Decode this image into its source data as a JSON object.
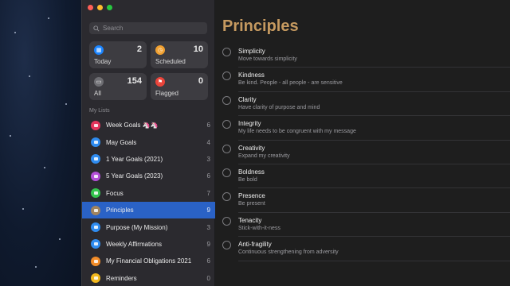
{
  "search": {
    "placeholder": "Search"
  },
  "smart_lists": [
    {
      "label": "Today",
      "count": "2",
      "color": "#1a84ff",
      "icon": "calendar-icon"
    },
    {
      "label": "Scheduled",
      "count": "10",
      "color": "#f0a030",
      "icon": "clock-icon"
    },
    {
      "label": "All",
      "count": "154",
      "color": "#6e6e73",
      "icon": "tray-icon"
    },
    {
      "label": "Flagged",
      "count": "0",
      "color": "#e9443a",
      "icon": "flag-icon"
    }
  ],
  "my_lists_title": "My Lists",
  "lists": [
    {
      "name": "Week Goals 🦄🦄",
      "count": "6",
      "color": "#e4355c"
    },
    {
      "name": "May Goals",
      "count": "4",
      "color": "#2f8cf0"
    },
    {
      "name": "1 Year Goals (2021)",
      "count": "3",
      "color": "#2f8cf0"
    },
    {
      "name": "5 Year Goals (2023)",
      "count": "6",
      "color": "#b44fd7"
    },
    {
      "name": "Focus",
      "count": "7",
      "color": "#34c44e"
    },
    {
      "name": "Principles",
      "count": "9",
      "color": "#a2845e",
      "selected": true
    },
    {
      "name": "Purpose (My Mission)",
      "count": "3",
      "color": "#2f8cf0"
    },
    {
      "name": "Weekly Affirmations",
      "count": "9",
      "color": "#2f8cf0"
    },
    {
      "name": "My Financial Obligations  2021",
      "count": "6",
      "color": "#f28c28"
    },
    {
      "name": "Reminders",
      "count": "0",
      "color": "#f2b81d"
    }
  ],
  "main": {
    "title": "Principles",
    "title_color": "#c69a60",
    "reminders": [
      {
        "title": "Simplicity",
        "note": "Move towards simplicity"
      },
      {
        "title": "Kindness",
        "note": "Be kind.  People - all people - are sensitive"
      },
      {
        "title": "Clarity",
        "note": "Have clarity of purpose and mind"
      },
      {
        "title": "Integrity",
        "note": "My life needs to be congruent with my message"
      },
      {
        "title": "Creativity",
        "note": "Expand my creativity"
      },
      {
        "title": "Boldness",
        "note": "Be bold"
      },
      {
        "title": "Presence",
        "note": "Be present"
      },
      {
        "title": "Tenacity",
        "note": "Stick-with-it-ness"
      },
      {
        "title": "Anti-fragility",
        "note": "Continuous strengthening from adversity"
      }
    ]
  }
}
